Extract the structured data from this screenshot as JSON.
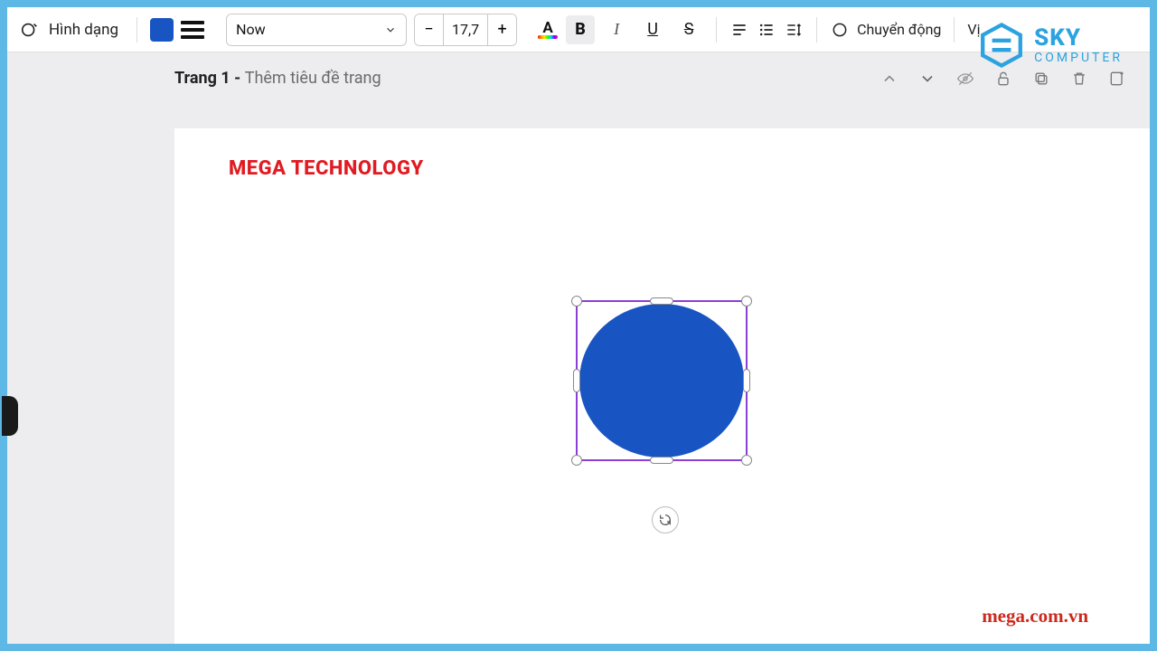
{
  "toolbar": {
    "edit_label": "Hình dạng",
    "fill_color": "#1955C2",
    "font_name": "Now",
    "font_size": "17,7",
    "animate_label": "Chuyển động",
    "position_label": "Vị"
  },
  "page": {
    "number_label": "Trang 1 - ",
    "title_placeholder": "Thêm tiêu đề trang"
  },
  "document": {
    "title": "MEGA TECHNOLOGY",
    "shape_fill": "#1955C2"
  },
  "watermark": {
    "brand1_line1": "SKY",
    "brand1_line2": "COMPUTER",
    "brand2": "mega.com.vn"
  },
  "icons": {
    "A": "A",
    "B": "B",
    "I": "I",
    "U": "U",
    "S": "S"
  }
}
